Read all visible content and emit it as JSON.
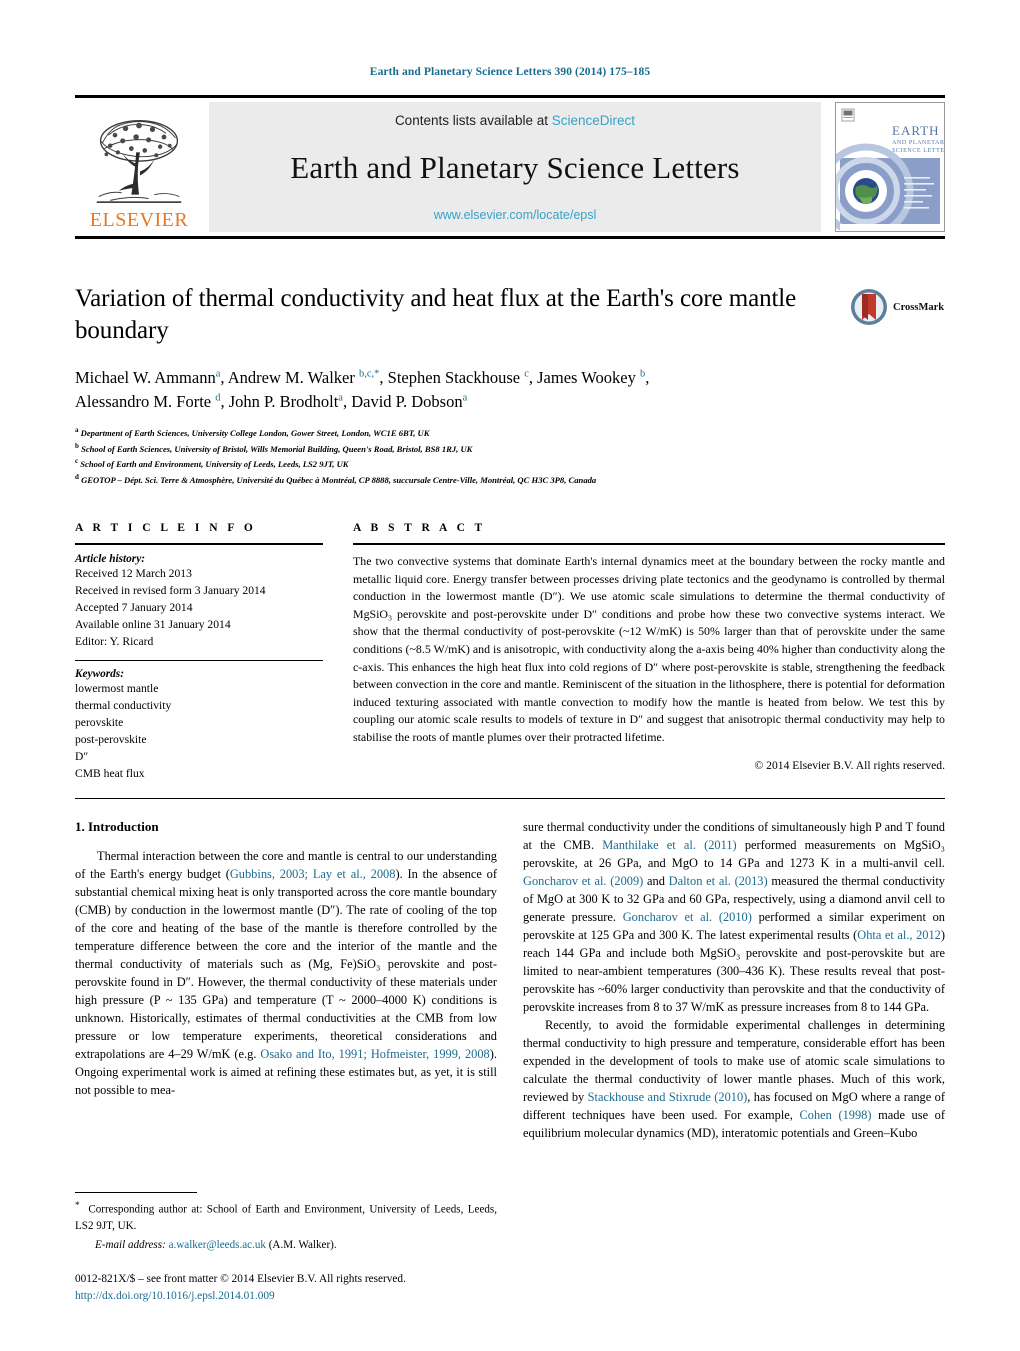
{
  "running_head": "Earth and Planetary Science Letters 390 (2014) 175–185",
  "masthead": {
    "contents_prefix": "Contents lists available at ",
    "sciencedirect": "ScienceDirect",
    "journal_title": "Earth and Planetary Science Letters",
    "journal_url": "www.elsevier.com/locate/epsl",
    "publisher_word": "ELSEVIER",
    "cover_title_line1": "EARTH",
    "cover_title_line2": "AND PLANETARY",
    "cover_title_line3": "SCIENCE LETTERS"
  },
  "article": {
    "title": "Variation of thermal conductivity and heat flux at the Earth's core mantle boundary",
    "crossmark_label": "CrossMark"
  },
  "authors": {
    "line1": [
      {
        "name": "Michael W. Ammann",
        "sup": "a",
        "sep": ", "
      },
      {
        "name": "Andrew M. Walker",
        "sup": "b,c,*",
        "sep": ", "
      },
      {
        "name": "Stephen Stackhouse",
        "sup": "c",
        "sep": ", "
      },
      {
        "name": "James Wookey",
        "sup": "b",
        "sep": ","
      }
    ],
    "line2": [
      {
        "name": "Alessandro M. Forte",
        "sup": "d",
        "sep": ", "
      },
      {
        "name": "John P. Brodholt",
        "sup": "a",
        "sep": ", "
      },
      {
        "name": "David P. Dobson",
        "sup": "a",
        "sep": ""
      }
    ]
  },
  "affiliations": [
    {
      "mark": "a",
      "text": "Department of Earth Sciences, University College London, Gower Street, London, WC1E 6BT, UK"
    },
    {
      "mark": "b",
      "text": "School of Earth Sciences, University of Bristol, Wills Memorial Building, Queen's Road, Bristol, BS8 1RJ, UK"
    },
    {
      "mark": "c",
      "text": "School of Earth and Environment, University of Leeds, Leeds, LS2 9JT, UK"
    },
    {
      "mark": "d",
      "text": "GEOTOP – Dépt. Sci. Terre & Atmosphère, Université du Québec à Montréal, CP 8888, succursale Centre-Ville, Montréal, QC H3C 3P8, Canada"
    }
  ],
  "article_info": {
    "heading": "A R T I C L E   I N F O",
    "history_label": "Article history:",
    "history": [
      "Received 12 March 2013",
      "Received in revised form 3 January 2014",
      "Accepted 7 January 2014",
      "Available online 31 January 2014",
      "Editor: Y. Ricard"
    ],
    "keywords_label": "Keywords:",
    "keywords": [
      "lowermost mantle",
      "thermal conductivity",
      "perovskite",
      "post-perovskite",
      "D″",
      "CMB heat flux"
    ]
  },
  "abstract": {
    "heading": "A B S T R A C T",
    "text": "The two convective systems that dominate Earth's internal dynamics meet at the boundary between the rocky mantle and metallic liquid core. Energy transfer between processes driving plate tectonics and the geodynamo is controlled by thermal conduction in the lowermost mantle (D″). We use atomic scale simulations to determine the thermal conductivity of MgSiO₃ perovskite and post-perovskite under D″ conditions and probe how these two convective systems interact. We show that the thermal conductivity of post-perovskite (~12 W/mK) is 50% larger than that of perovskite under the same conditions (~8.5 W/mK) and is anisotropic, with conductivity along the a-axis being 40% higher than conductivity along the c-axis. This enhances the high heat flux into cold regions of D″ where post-perovskite is stable, strengthening the feedback between convection in the core and mantle. Reminiscent of the situation in the lithosphere, there is potential for deformation induced texturing associated with mantle convection to modify how the mantle is heated from below. We test this by coupling our atomic scale results to models of texture in D″ and suggest that anisotropic thermal conductivity may help to stabilise the roots of mantle plumes over their protracted lifetime.",
    "copyright": "© 2014 Elsevier B.V. All rights reserved."
  },
  "body": {
    "section_title": "1. Introduction",
    "left_paragraph_1_parts": {
      "t1": "Thermal interaction between the core and mantle is central to our understanding of the Earth's energy budget (",
      "ref1": "Gubbins, 2003; Lay et al., 2008",
      "t2": "). In the absence of substantial chemical mixing heat is only transported across the core mantle boundary (CMB) by conduction in the lowermost mantle (D″). The rate of cooling of the top of the core and heating of the base of the mantle is therefore controlled by the temperature difference between the core and the interior of the mantle and the thermal conductivity of materials such as (Mg, Fe)SiO₃ perovskite and post-perovskite found in D″. However, the thermal conductivity of these materials under high pressure (P ~ 135 GPa) and temperature (T ~ 2000–4000 K) conditions is unknown. Historically, estimates of thermal conductivities at the CMB from low pressure or low temperature experiments, theoretical considerations and extrapolations are 4–29 W/mK (e.g. ",
      "ref2": "Osako and Ito, 1991; Hofmeister, 1999, 2008",
      "t3": "). Ongoing experimental work is aimed at refining these estimates but, as yet, it is still not possible to mea-"
    },
    "right_paragraph_1_parts": {
      "t1": "sure thermal conductivity under the conditions of simultaneously high P and T found at the CMB. ",
      "ref1": "Manthilake et al. (2011)",
      "t2": " performed measurements on MgSiO₃ perovskite, at 26 GPa, and MgO to 14 GPa and 1273 K in a multi-anvil cell. ",
      "ref2": "Goncharov et al. (2009)",
      "t3": " and ",
      "ref3": "Dalton et al. (2013)",
      "t4": " measured the thermal conductivity of MgO at 300 K to 32 GPa and 60 GPa, respectively, using a diamond anvil cell to generate pressure. ",
      "ref4": "Goncharov et al. (2010)",
      "t5": " performed a similar experiment on perovskite at 125 GPa and 300 K. The latest experimental results (",
      "ref5": "Ohta et al., 2012",
      "t6": ") reach 144 GPa and include both MgSiO₃ perovskite and post-perovskite but are limited to near-ambient temperatures (300–436 K). These results reveal that post-perovskite has ~60% larger conductivity than perovskite and that the conductivity of perovskite increases from 8 to 37 W/mK as pressure increases from 8 to 144 GPa."
    },
    "right_paragraph_2_parts": {
      "t1": "Recently, to avoid the formidable experimental challenges in determining thermal conductivity to high pressure and temperature, considerable effort has been expended in the development of tools to make use of atomic scale simulations to calculate the thermal conductivity of lower mantle phases. Much of this work, reviewed by ",
      "ref1": "Stackhouse and Stixrude (2010)",
      "t2": ", has focused on MgO where a range of different techniques have been used. For example, ",
      "ref2": "Cohen (1998)",
      "t3": " made use of equilibrium molecular dynamics (MD), interatomic potentials and Green–Kubo"
    }
  },
  "footnotes": {
    "corresponding_mark": "*",
    "corresponding_text": "Corresponding author at: School of Earth and Environment, University of Leeds, Leeds, LS2 9JT, UK.",
    "email_label": "E-mail address:",
    "email": "a.walker@leeds.ac.uk",
    "email_attrib": "(A.M. Walker).",
    "issn_line": "0012-821X/$ – see front matter © 2014 Elsevier B.V. All rights reserved.",
    "doi": "http://dx.doi.org/10.1016/j.epsl.2014.01.009"
  },
  "colors": {
    "link": "#1a6b8f",
    "sciencedirect": "#37A2C8",
    "elsevier_orange": "#E87722"
  }
}
